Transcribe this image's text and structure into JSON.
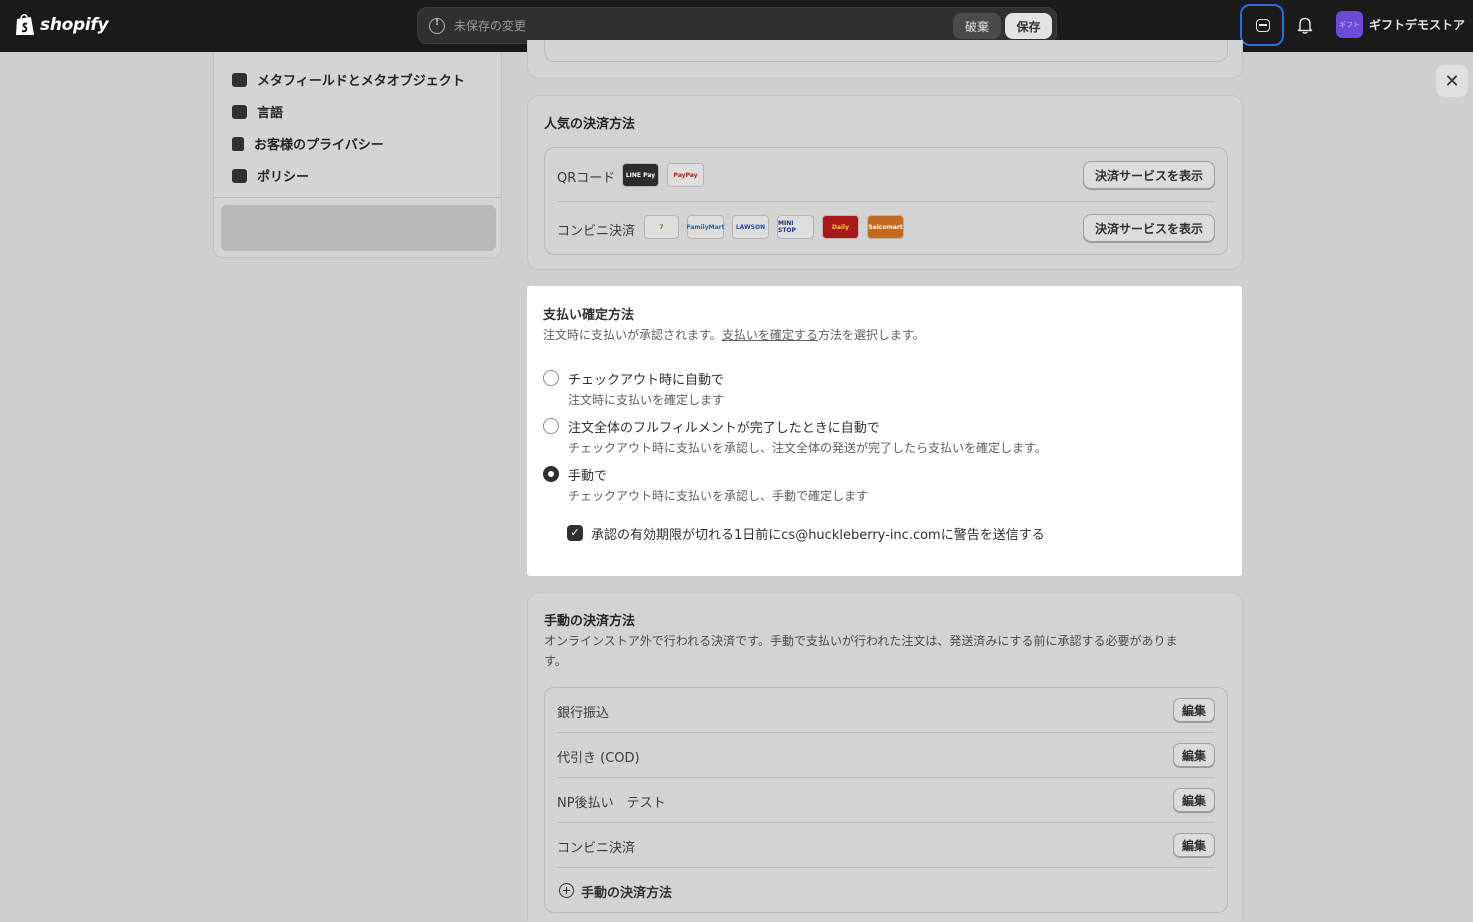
{
  "topbar": {
    "logo_text": "shopify",
    "unsaved_text": "未保存の変更",
    "discard_label": "破棄",
    "save_label": "保存",
    "store_avatar": "ギフト",
    "store_name": "ギフトデモストア"
  },
  "sidebar": {
    "items": [
      {
        "label": "メタフィールドとメタオブジェクト",
        "icon": "metafields-icon"
      },
      {
        "label": "言語",
        "icon": "language-icon"
      },
      {
        "label": "お客様のプライバシー",
        "icon": "lock-icon"
      },
      {
        "label": "ポリシー",
        "icon": "policy-icon"
      }
    ]
  },
  "popular_methods": {
    "title": "人気の決済方法",
    "rows": [
      {
        "label": "QRコード",
        "button": "決済サービスを表示",
        "logos": [
          "LINE Pay",
          "PayPay"
        ]
      },
      {
        "label": "コンビニ決済",
        "button": "決済サービスを表示",
        "logos": [
          "7",
          "FamilyMart",
          "LAWSON",
          "MINI STOP",
          "Daily",
          "Seicomart"
        ]
      }
    ]
  },
  "capture": {
    "title": "支払い確定方法",
    "desc_before": "注文時に支払いが承認されます。",
    "desc_link": "支払いを確定する",
    "desc_after": "方法を選択します。",
    "options": [
      {
        "label": "チェックアウト時に自動で",
        "help": "注文時に支払いを確定します",
        "checked": false
      },
      {
        "label": "注文全体のフルフィルメントが完了したときに自動で",
        "help": "チェックアウト時に支払いを承認し、注文全体の発送が完了したら支払いを確定します。",
        "checked": false
      },
      {
        "label": "手動で",
        "help": "チェックアウト時に支払いを承認し、手動で確定します",
        "checked": true
      }
    ],
    "checkbox_label": "承認の有効期限が切れる1日前にcs@huckleberry-inc.comに警告を送信する"
  },
  "manual_methods": {
    "title": "手動の決済方法",
    "desc_line1": "オンラインストア外で行われる決済です。手動で支払いが行われた注文は、発送済みにする前に承認する必要がありま",
    "desc_line2": "す。",
    "rows": [
      {
        "label": "銀行振込",
        "button": "編集"
      },
      {
        "label": "代引き (COD)",
        "button": "編集"
      },
      {
        "label": "NP後払い　テスト",
        "button": "編集"
      },
      {
        "label": "コンビニ決済",
        "button": "編集"
      }
    ],
    "add_label": "手動の決済方法"
  },
  "colors": {
    "accent": "#2f6ae0",
    "topbar": "#1a1a1a",
    "avatar": "#6b4ad6"
  }
}
